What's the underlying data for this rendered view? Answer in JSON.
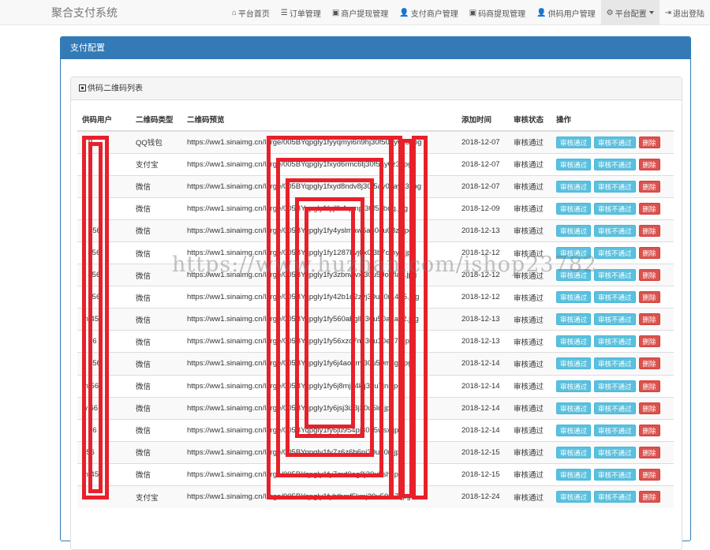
{
  "brand": "聚合支付系统",
  "nav": [
    {
      "icon": "⌂",
      "icon_name": "home-icon",
      "label": "平台首页"
    },
    {
      "icon": "☰",
      "icon_name": "list-icon",
      "label": "订单管理"
    },
    {
      "icon": "▣",
      "icon_name": "credit-card-icon",
      "label": "商户提现管理"
    },
    {
      "icon": "👤",
      "icon_name": "user-icon",
      "label": "支付商户管理"
    },
    {
      "icon": "▣",
      "icon_name": "credit-card-icon",
      "label": "码商提现管理"
    },
    {
      "icon": "👤",
      "icon_name": "user-icon",
      "label": "供码用户管理"
    },
    {
      "icon": "⚙",
      "icon_name": "gear-icon",
      "label": "平台配置"
    },
    {
      "icon": "⇥",
      "icon_name": "logout-icon",
      "label": "退出登陆"
    }
  ],
  "panel_title": "支付配置",
  "list_title": "供码二维码列表",
  "columns": [
    "供码用户",
    "二维码类型",
    "二维码预览",
    "添加时间",
    "审核状态",
    "操作"
  ],
  "buttons": {
    "approve": "审核通过",
    "reject": "审核不通过",
    "delete": "删除"
  },
  "rows": [
    {
      "user": "5   9",
      "type": "QQ钱包",
      "preview": "https://ww1.sinaimg.cn/large/005BYqpgly1fyyqmyi6n9hj30f50ay0z3.jpg",
      "date": "2018-12-07",
      "status": "审核通过"
    },
    {
      "user": "5   9",
      "type": "支付宝",
      "preview": "https://ww1.sinaimg.cn/large/005BYqpgly1fxyd6rmc6tj30f5ay0z3.jpg",
      "date": "2018-12-07",
      "status": "审核通过"
    },
    {
      "user": "4",
      "type": "微信",
      "preview": "https://ww1.sinaimg.cn/large/005BYqpgly1fxyd8ndv8j30f5ay0Jayz3.jpg",
      "date": "2018-12-07",
      "status": "审核通过"
    },
    {
      "user": "5   9",
      "type": "微信",
      "preview": "https://ww1.sinaimg.cn/large/005BYqpgly1fyjllb4qnnpj30f50bdq.jpg",
      "date": "2018-12-09",
      "status": "审核通过"
    },
    {
      "user": "d   456",
      "type": "微信",
      "preview": "https://ww1.sinaimg.cn/large/005BYqpgly1fy4yslmaw6a30ou08zl.jpg",
      "date": "2018-12-13",
      "status": "审核通过"
    },
    {
      "user": "x   456",
      "type": "微信",
      "preview": "https://ww1.sinaimg.cn/large/005BYqpgly1fy1287bvj0x0l3b7cmyg.jpg",
      "date": "2018-12-12",
      "status": "审核通过"
    },
    {
      "user": "s   456",
      "type": "微信",
      "preview": "https://ww1.sinaimg.cn/large/005BYqpgly1fy3zbnwvxj30u50osfla9.jpg",
      "date": "2018-12-12",
      "status": "审核通过"
    },
    {
      "user": "y   456",
      "type": "微信",
      "preview": "https://ww1.sinaimg.cn/large/005BYqpgly1fy42b1q2zvj30u50r1405.jpg",
      "date": "2018-12-12",
      "status": "审核通过"
    },
    {
      "user": "m   456",
      "type": "微信",
      "preview": "https://ww1.sinaimg.cn/large/005BYqpgly1fy560abglkj30u50a1aa2.jpg",
      "date": "2018-12-13",
      "status": "审核通过"
    },
    {
      "user": "g   56",
      "type": "微信",
      "preview": "https://ww1.sinaimg.cn/large/005BYqpgly1fy56xzo7mj30u10e77v.jpg",
      "date": "2018-12-13",
      "status": "审核通过"
    },
    {
      "user": "h   456",
      "type": "微信",
      "preview": "https://ww1.sinaimg.cn/large/005BYqpgly1fy6j4ao7mj30u50mxgj.jpg",
      "date": "2018-12-14",
      "status": "审核通过"
    },
    {
      "user": "m   56",
      "type": "微信",
      "preview": "https://ww1.sinaimg.cn/large/005BYqpgly1fy6j8mjz4kjj30u7jnl.jpg",
      "date": "2018-12-14",
      "status": "审核通过"
    },
    {
      "user": "w   56",
      "type": "微信",
      "preview": "https://ww1.sinaimg.cn/large/005BYqpgly1fy6jsj3iz3j30u5ld.jpg",
      "date": "2018-12-14",
      "status": "审核通过"
    },
    {
      "user": "b   56",
      "type": "微信",
      "preview": "https://ww1.sinaimg.cn/large/005BYqpgly1fy6ju954pj30u5wsx.jpg",
      "date": "2018-12-14",
      "status": "审核通过"
    },
    {
      "user": "f   56",
      "type": "微信",
      "preview": "https://ww1.sinaimg.cn/large/005BYqpgly1fy7z6z6b6nj30u70n.jpg",
      "date": "2018-12-15",
      "status": "审核通过"
    },
    {
      "user": "m   456",
      "type": "微信",
      "preview": "https://ww1.sinaimg.cn/large/005BYqpgly1fy7zrd0ag8j30u5sh.jpg",
      "date": "2018-12-15",
      "status": "审核通过"
    },
    {
      "user": "c",
      "type": "支付宝",
      "preview": "https://ww1.sinaimg.cn/large/005BYqpgly1fyhtbmf5kmj30u50m7.jpg",
      "date": "2018-12-24",
      "status": "审核通过"
    }
  ],
  "watermark": "https://www.huzhan.com/ishop23782",
  "colors": {
    "primary": "#337ab7",
    "info": "#5bc0de",
    "danger": "#d9534f",
    "annotation": "#e8202a"
  }
}
